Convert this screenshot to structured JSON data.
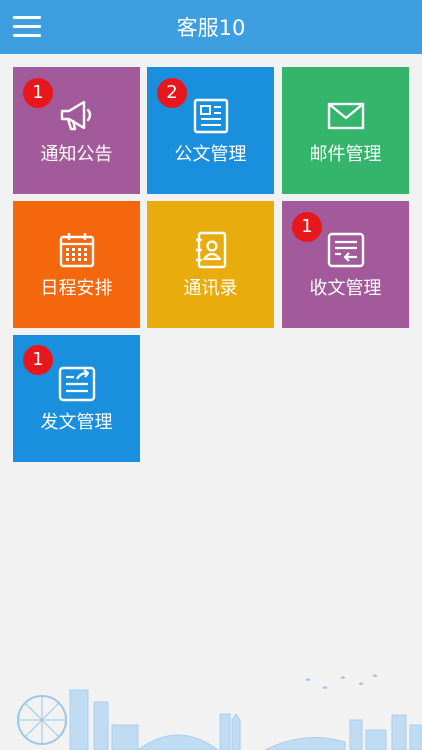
{
  "header": {
    "title": "客服10"
  },
  "tiles": [
    {
      "label": "通知公告",
      "badge": "1",
      "color": "#a25a9b",
      "icon": "megaphone-icon"
    },
    {
      "label": "公文管理",
      "badge": "2",
      "color": "#1a8fdd",
      "icon": "newspaper-icon"
    },
    {
      "label": "邮件管理",
      "badge": "",
      "color": "#34b56b",
      "icon": "mail-icon"
    },
    {
      "label": "日程安排",
      "badge": "",
      "color": "#f5670c",
      "icon": "calendar-icon"
    },
    {
      "label": "通讯录",
      "badge": "",
      "color": "#e8ad0d",
      "icon": "contacts-icon"
    },
    {
      "label": "收文管理",
      "badge": "1",
      "color": "#a25a9b",
      "icon": "inbox-doc-icon"
    },
    {
      "label": "发文管理",
      "badge": "1",
      "color": "#1a8fdd",
      "icon": "send-doc-icon"
    }
  ]
}
